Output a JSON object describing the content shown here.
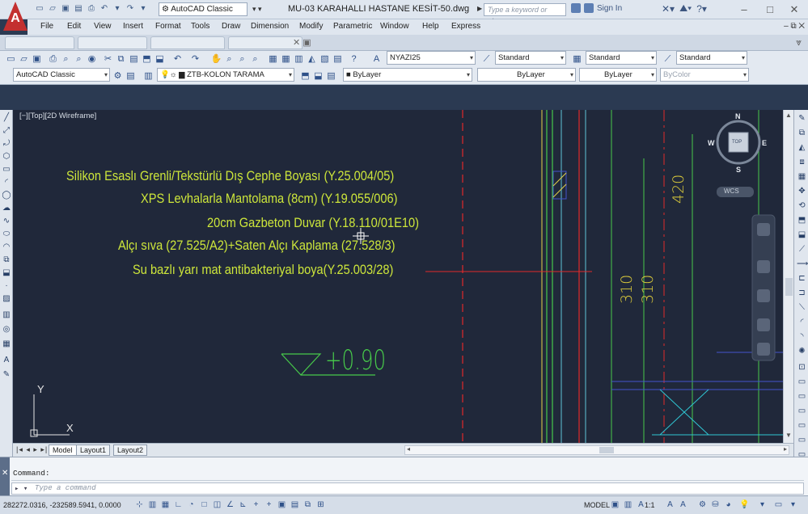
{
  "titlebar": {
    "workspace": "AutoCAD Classic",
    "document_title": "MU-03 KARAHALLI HASTANE KESİT-50.dwg",
    "search_placeholder": "Type a keyword or phrase",
    "sign_in": "Sign In",
    "logo_letter": "A"
  },
  "menu": {
    "items": [
      "File",
      "Edit",
      "View",
      "Insert",
      "Format",
      "Tools",
      "Draw",
      "Dimension",
      "Modify",
      "Parametric",
      "Window",
      "Help",
      "Express"
    ]
  },
  "toolbar": {
    "text_style": "NYAZI25",
    "dim_style": "Standard",
    "table_style": "Standard",
    "multileader_style": "Standard",
    "workspace_combo": "AutoCAD Classic",
    "layer_combo": "ZTB-KOLON TARAMA",
    "color_combo": "ByLayer",
    "linetype_combo": "ByLayer",
    "lineweight_combo": "ByLayer",
    "plotstyle_combo": "ByColor"
  },
  "viewport": {
    "label": "[−][Top][2D Wireframe]",
    "annotations": [
      "Silikon Esaslı Grenli/Tekstürlü Dış Cephe Boyası (Y.25.004/05)",
      "XPS Levhalarla Mantolama (8cm) (Y.19.055/006)",
      "20cm Gazbeton Duvar (Y.18.110/01E10)",
      "Alçı sıva (27.525/A2)+Saten Alçı Kaplama (27.528/3)",
      "Su bazlı yarı mat antibakteriyal boya(Y.25.003/28)"
    ],
    "level_mark": "+0.90",
    "dims": [
      "420",
      "310",
      "310"
    ],
    "compass": {
      "n": "N",
      "s": "S",
      "e": "E",
      "w": "W",
      "top": "TOP"
    },
    "wcs": "WCS",
    "ucs_y": "Y",
    "ucs_x": "X"
  },
  "layout_tabs": [
    "Model",
    "Layout1",
    "Layout2"
  ],
  "command": {
    "history": "Command:",
    "placeholder": "Type a command"
  },
  "status": {
    "coords": "282272.0316, -232589.5941, 0.0000",
    "model": "MODEL",
    "scale": "1:1"
  },
  "colors": {
    "canvas": "#20283a",
    "annotation_text": "#cde63a",
    "red_line": "#e02a2a",
    "green_line": "#47c94a",
    "cyan_line": "#2fc6d3",
    "yellow_text": "#d9c93b"
  }
}
